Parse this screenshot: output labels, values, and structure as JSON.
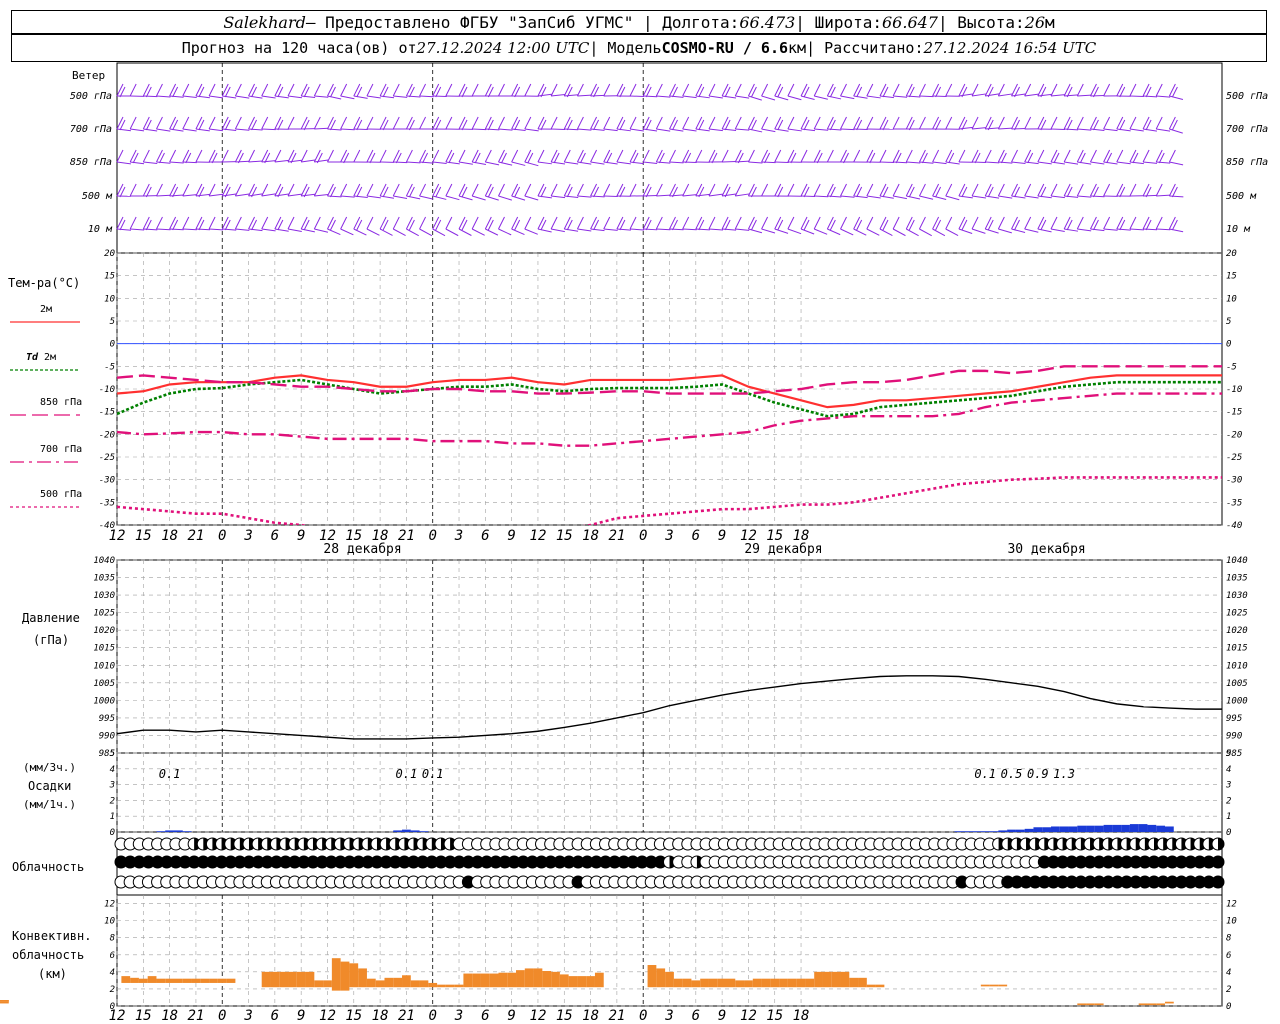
{
  "header": {
    "station": "Salekhard",
    "provided": " – Предоставлено ФГБУ \"ЗапСиб УГМС\" | Долгота: ",
    "lon": "66.473",
    "lat_label": " | Широта: ",
    "lat": "66.647",
    "alt_label": " | Высота: ",
    "alt": "26",
    "alt_unit": "м",
    "forecast_prefix": "Прогноз на 120 часа(ов) от ",
    "forecast_time": "27.12.2024 12:00 UTC",
    "model_label": " | Модель ",
    "model": "COSMO-RU / 6.6",
    "model_unit": "км",
    "calc_label": " | Рассчитано: ",
    "calc_time": "27.12.2024 16:54 UTC"
  },
  "hour_ticks": [
    "12",
    "15",
    "18",
    "21",
    "0",
    "3",
    "6",
    "9",
    "12",
    "15",
    "18",
    "21",
    "0",
    "3",
    "6",
    "9",
    "12",
    "15",
    "18",
    "21",
    "0",
    "3",
    "6",
    "9",
    "12",
    "15",
    "18"
  ],
  "day_labels": [
    "28 декабря",
    "29 декабря",
    "30 декабря"
  ],
  "labels": {
    "wind": "Ветер",
    "wind_levels": [
      "500 гПа",
      "700 гПа",
      "850 гПа",
      "500 м",
      "10  м"
    ],
    "temp": "Тем-ра(°С)",
    "t2m": "2м",
    "td": "Td",
    "td2": " 2м",
    "t850": "850 гПа",
    "t700": "700 гПа",
    "t500": "500 гПа",
    "pressure": "Давление",
    "pressure_unit": "(гПа)",
    "precip_top": "(мм/3ч.)",
    "precip": "Осадки",
    "precip_bottom": "(мм/1ч.)",
    "cloud": "Облачность",
    "conv1": "Конвективн.",
    "conv2": "облачность",
    "conv3": "(км)"
  },
  "colors": {
    "wind": "#8a2be2",
    "t2m": "#ff3030",
    "td": "#008000",
    "t850": "#e0107a",
    "t700": "#e0107a",
    "t500": "#e0107a",
    "pressure": "#000000",
    "precip": "#1a3ad6",
    "conv": "#f08a2a",
    "zero": "#3050ff"
  },
  "chart_data": [
    {
      "type": "line",
      "panel": "temperature",
      "ylim": [
        -40,
        20
      ],
      "yticks": [
        20,
        15,
        10,
        5,
        0,
        -5,
        -10,
        -15,
        -20,
        -25,
        -30,
        -35,
        -40
      ],
      "x_hours": [
        0,
        3,
        6,
        9,
        12,
        15,
        18,
        21,
        24,
        27,
        30,
        33,
        36,
        39,
        42,
        45,
        48,
        51,
        54,
        57,
        60,
        63,
        66,
        69,
        72,
        75,
        78,
        81,
        84,
        87,
        90,
        93,
        96,
        99,
        102,
        105,
        108,
        111,
        114,
        117,
        120,
        123,
        126
      ],
      "series": [
        {
          "name": "2м",
          "values": [
            -11,
            -10.5,
            -9,
            -8.5,
            -8.5,
            -8.5,
            -7.5,
            -7,
            -8,
            -8.5,
            -9.5,
            -9.5,
            -8.5,
            -8,
            -8,
            -7.5,
            -8.5,
            -9,
            -8,
            -8,
            -8,
            -8,
            -7.5,
            -7,
            -9.5,
            -11,
            -12.5,
            -14,
            -13.5,
            -12.5,
            -12.5,
            -12,
            -11.5,
            -11,
            -10.5,
            -9.5,
            -8.5,
            -7.5,
            -7,
            -7,
            -7,
            -7,
            -7
          ]
        },
        {
          "name": "Td 2м",
          "values": [
            -15.5,
            -13,
            -11,
            -10,
            -9.8,
            -9,
            -8.5,
            -8,
            -9,
            -10,
            -11,
            -10.5,
            -10,
            -9.5,
            -9.5,
            -9,
            -10,
            -10.5,
            -10,
            -9.8,
            -9.8,
            -9.8,
            -9.5,
            -9,
            -11,
            -13,
            -14.5,
            -16,
            -15.5,
            -14,
            -13.5,
            -13,
            -12.5,
            -12,
            -11.5,
            -10.5,
            -9.5,
            -9,
            -8.5,
            -8.5,
            -8.5,
            -8.5,
            -8.5
          ]
        },
        {
          "name": "850 гПа",
          "values": [
            -7.5,
            -7,
            -7.5,
            -8,
            -8.5,
            -8.5,
            -9,
            -9.5,
            -9.5,
            -10,
            -10.5,
            -10.5,
            -10,
            -10,
            -10.5,
            -10.5,
            -11,
            -11,
            -10.8,
            -10.5,
            -10.5,
            -11,
            -11,
            -11,
            -11,
            -10.5,
            -10,
            -9,
            -8.5,
            -8.5,
            -8,
            -7,
            -6,
            -6,
            -6.5,
            -6,
            -5,
            -5,
            -5,
            -5,
            -5,
            -5,
            -5
          ]
        },
        {
          "name": "700 гПа",
          "values": [
            -19.5,
            -20,
            -19.8,
            -19.5,
            -19.5,
            -20,
            -20,
            -20.5,
            -21,
            -21,
            -21,
            -21,
            -21.5,
            -21.5,
            -21.5,
            -22,
            -22,
            -22.5,
            -22.5,
            -22,
            -21.5,
            -21,
            -20.5,
            -20,
            -19.5,
            -18,
            -17,
            -16.5,
            -16,
            -16,
            -16,
            -16,
            -15.5,
            -14,
            -13,
            -12.5,
            -12,
            -11.5,
            -11,
            -11,
            -11,
            -11,
            -11
          ]
        },
        {
          "name": "500 гПа",
          "values": [
            -36,
            -36.5,
            -37,
            -37.5,
            -37.5,
            -38.5,
            -39.5,
            -40,
            -41,
            -42,
            -42.5,
            -42.5,
            -42,
            -42,
            -41.5,
            -41,
            -40.5,
            -41,
            -40,
            -38.5,
            -38,
            -37.5,
            -37,
            -36.5,
            -36.5,
            -36,
            -35.5,
            -35.5,
            -35,
            -34,
            -33,
            -32,
            -31,
            -30.5,
            -30,
            -29.8,
            -29.5,
            -29.5,
            -29.5,
            -29.5,
            -29.5,
            -29.5,
            -29.5
          ]
        }
      ]
    },
    {
      "type": "line",
      "panel": "pressure",
      "ylim": [
        985,
        1040
      ],
      "yticks": [
        1040,
        1035,
        1030,
        1025,
        1020,
        1015,
        1010,
        1005,
        1000,
        995,
        990,
        985
      ],
      "x_hours": [
        0,
        3,
        6,
        9,
        12,
        15,
        18,
        21,
        24,
        27,
        30,
        33,
        36,
        39,
        42,
        45,
        48,
        51,
        54,
        57,
        60,
        63,
        66,
        69,
        72,
        75,
        78,
        81,
        84,
        87,
        90,
        93,
        96,
        99,
        102,
        105,
        108,
        111,
        114,
        117,
        120,
        123,
        126
      ],
      "series": [
        {
          "name": "Давление",
          "values": [
            990.5,
            991.5,
            991.5,
            991,
            991.5,
            991,
            990.5,
            990,
            989.5,
            989,
            989,
            989,
            989.3,
            989.5,
            990,
            990.5,
            991.2,
            992.3,
            993.5,
            995,
            996.5,
            998.5,
            1000,
            1001.5,
            1002.8,
            1003.8,
            1004.8,
            1005.5,
            1006.2,
            1006.8,
            1007,
            1007,
            1006.8,
            1006,
            1005,
            1004,
            1002.5,
            1000.5,
            999,
            998.2,
            997.8,
            997.5,
            997.5
          ]
        }
      ]
    },
    {
      "type": "bar",
      "panel": "precipitation",
      "ylim": [
        0,
        5
      ],
      "yticks": [
        5,
        4,
        3,
        2,
        1,
        0
      ],
      "annotations": [
        {
          "hour": 6,
          "text": "0.1"
        },
        {
          "hour": 33,
          "text": "0.1"
        },
        {
          "hour": 36,
          "text": "0.1"
        },
        {
          "hour": 99,
          "text": "0.1"
        },
        {
          "hour": 102,
          "text": "0.5"
        },
        {
          "hour": 105,
          "text": "0.9"
        },
        {
          "hour": 108,
          "text": "1.3"
        }
      ],
      "x_hours": [
        5,
        6,
        7,
        8,
        32,
        33,
        34,
        35,
        96,
        97,
        98,
        99,
        100,
        101,
        102,
        103,
        104,
        105,
        106,
        107,
        108,
        109,
        110,
        111,
        112,
        113,
        114,
        115,
        116,
        117,
        118,
        119,
        120
      ],
      "values": [
        0.05,
        0.1,
        0.1,
        0.05,
        0.1,
        0.15,
        0.1,
        0.05,
        0.05,
        0.05,
        0.05,
        0.05,
        0.05,
        0.1,
        0.15,
        0.15,
        0.2,
        0.3,
        0.3,
        0.35,
        0.35,
        0.35,
        0.4,
        0.4,
        0.4,
        0.45,
        0.45,
        0.45,
        0.5,
        0.5,
        0.45,
        0.4,
        0.35
      ]
    },
    {
      "type": "bar",
      "panel": "convective_cloud",
      "ylim": [
        0,
        13
      ],
      "yticks": [
        12,
        10,
        8,
        6,
        4,
        2,
        0
      ],
      "x_hours": [
        1,
        2,
        3,
        4,
        5,
        6,
        7,
        8,
        9,
        10,
        11,
        12,
        13,
        14,
        15,
        16,
        17,
        18,
        19,
        20,
        21,
        22,
        23,
        24,
        25,
        26,
        27,
        28,
        29,
        30,
        31,
        32,
        33,
        34,
        35,
        36,
        37,
        38,
        39,
        40,
        41,
        42,
        43,
        44,
        45,
        46,
        47,
        48,
        49,
        50,
        51,
        52,
        53,
        54,
        55,
        56,
        57,
        58,
        59,
        60,
        61,
        62,
        63,
        64,
        65,
        66,
        67,
        68,
        69,
        70,
        71,
        72,
        73,
        74,
        75,
        76,
        77,
        78,
        79,
        80,
        81,
        82,
        83,
        84,
        85,
        86,
        87,
        88,
        89,
        90,
        91,
        92,
        93,
        94,
        95,
        96,
        97,
        98,
        99,
        100,
        101,
        102,
        103,
        104,
        105,
        106,
        107,
        108,
        109,
        110,
        111,
        112,
        113,
        114,
        115,
        116,
        117,
        118,
        119,
        120
      ],
      "bottoms": [
        2.7,
        2.7,
        2.7,
        2.7,
        2.7,
        2.7,
        2.7,
        2.7,
        2.7,
        2.7,
        2.7,
        2.7,
        2.7,
        2.7,
        2.7,
        2.7,
        2.2,
        2.2,
        2.2,
        2.2,
        2.2,
        2.2,
        2.2,
        2.2,
        1.8,
        1.8,
        2.2,
        2.2,
        2.2,
        2.2,
        2.2,
        2.2,
        2.2,
        2.2,
        2.2,
        2.2,
        2.2,
        2.2,
        2.2,
        2.2,
        2.2,
        2.2,
        2.2,
        2.2,
        2.2,
        2.2,
        2.2,
        2.2,
        2.2,
        2.2,
        2.2,
        2.2,
        2.2,
        2.2,
        2.2,
        2.2,
        2.2,
        2.2,
        2.2,
        2.2,
        2.2,
        2.2,
        2.2,
        2.2,
        2.2,
        2.2,
        2.2,
        2.2,
        2.2,
        2.2,
        2.2,
        2.2,
        2.2,
        2.2,
        2.2,
        2.2,
        2.2,
        2.2,
        2.2,
        2.2,
        2.2,
        2.2,
        2.2,
        2.2,
        2.2,
        2.2,
        2.2,
        2.2,
        2.2,
        2.2,
        2.2,
        2.2,
        2.2,
        2.2,
        2.2,
        2.2,
        0,
        0,
        0,
        0,
        0,
        0,
        0,
        0,
        0,
        0,
        0,
        0,
        0,
        0,
        0,
        0,
        0,
        0,
        0,
        0,
        0,
        0,
        0,
        0
      ],
      "values": [
        3.5,
        3.3,
        3.2,
        3.5,
        3.2,
        3.2,
        3.2,
        3.2,
        3.2,
        3.2,
        3.2,
        3.2,
        3.2,
        2.7,
        2.7,
        2.7,
        4,
        4,
        4,
        4,
        4,
        4,
        3,
        3,
        5.6,
        5.2,
        5,
        4.4,
        3.2,
        3,
        3.3,
        3.3,
        3.6,
        3,
        3,
        2.7,
        2.5,
        2.5,
        2.5,
        3.8,
        3.8,
        3.8,
        3.8,
        3.9,
        3.9,
        4.2,
        4.4,
        4.4,
        4.1,
        4,
        3.7,
        3.5,
        3.5,
        3.5,
        3.9,
        0,
        0,
        0,
        0,
        0,
        4.8,
        4.4,
        4,
        3.2,
        3.2,
        3,
        3.2,
        3.2,
        3.2,
        3.2,
        3,
        3,
        3.2,
        3.2,
        3.2,
        3.2,
        3.2,
        3.2,
        3.2,
        4,
        4,
        4,
        4,
        3.3,
        3.3,
        2.5,
        2.5,
        0,
        0,
        0,
        0,
        0,
        0,
        0,
        0,
        0,
        0,
        0,
        2.5,
        2.5,
        2.5,
        0,
        0,
        0,
        0,
        0,
        0,
        0,
        0,
        0.3,
        0.3,
        0.3,
        0,
        0,
        0,
        0,
        0.3,
        0.3,
        0.3,
        0.5,
        0.5,
        0,
        0.7,
        0.7
      ]
    }
  ]
}
